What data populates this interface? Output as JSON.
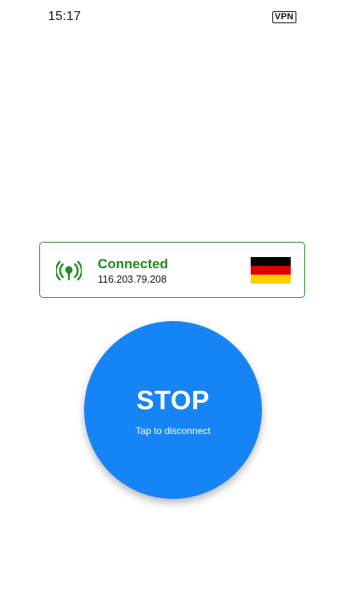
{
  "status_bar": {
    "time": "15:17",
    "vpn_badge": "VPN"
  },
  "connection": {
    "status": "Connected",
    "ip_address": "116.203.79.208",
    "status_icon": "signal-broadcast-icon",
    "country_flag": "germany-flag",
    "flag_colors": [
      "#000000",
      "#dd0000",
      "#ffce00"
    ],
    "status_color": "#1f8a1f"
  },
  "action_button": {
    "label": "STOP",
    "hint": "Tap to disconnect",
    "color": "#1784f5"
  }
}
